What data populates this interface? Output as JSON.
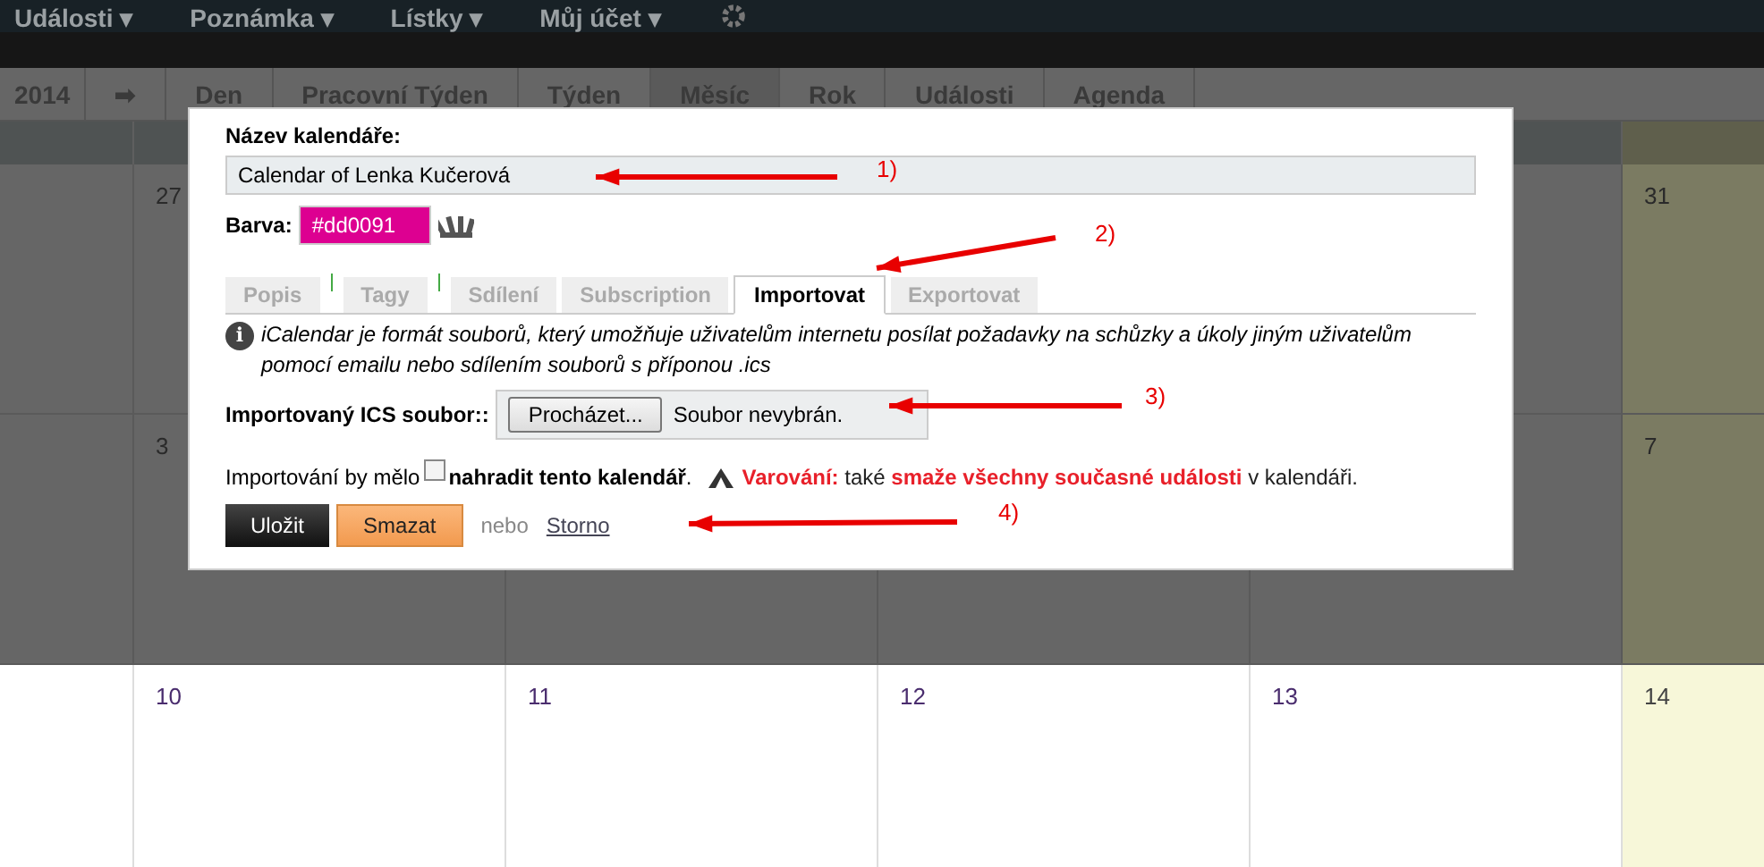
{
  "top_menu": [
    {
      "label": "Události",
      "caret": "▾"
    },
    {
      "label": "Poznámka",
      "caret": "▾"
    },
    {
      "label": "Lístky",
      "caret": "▾"
    },
    {
      "label": "Můj účet",
      "caret": "▾"
    }
  ],
  "toolbar": {
    "year": "2014",
    "next": "➡",
    "views": [
      {
        "label": "Den",
        "selected": false
      },
      {
        "label": "Pracovní Týden",
        "selected": false
      },
      {
        "label": "Týden",
        "selected": false
      },
      {
        "label": "Měsíc",
        "selected": true
      },
      {
        "label": "Rok",
        "selected": false
      },
      {
        "label": "Události",
        "selected": false
      },
      {
        "label": "Agenda",
        "selected": false
      }
    ]
  },
  "calendar": {
    "rows": [
      {
        "dimmed": true,
        "cells": [
          {
            "kind": "day",
            "day": "27"
          },
          {
            "kind": "empty"
          },
          {
            "kind": "empty"
          },
          {
            "kind": "empty"
          },
          {
            "kind": "day",
            "day": "31"
          }
        ]
      },
      {
        "dimmed": true,
        "cells": [
          {
            "kind": "day",
            "day": "3"
          },
          {
            "kind": "empty"
          },
          {
            "kind": "empty"
          },
          {
            "kind": "empty"
          },
          {
            "kind": "day",
            "day": "7"
          }
        ]
      },
      {
        "dimmed": false,
        "cells": [
          {
            "kind": "day",
            "day": "10"
          },
          {
            "kind": "day",
            "day": "11"
          },
          {
            "kind": "day",
            "day": "12"
          },
          {
            "kind": "day",
            "day": "13"
          },
          {
            "kind": "day",
            "day": "14"
          }
        ]
      }
    ]
  },
  "dialog": {
    "name_label": "Název kalendáře:",
    "name_value": "Calendar of Lenka Kučerová",
    "color_label": "Barva:",
    "color_value": "#dd0091",
    "tabs": [
      {
        "label": "Popis",
        "selected": false,
        "separator": false
      },
      {
        "label": "Tagy",
        "selected": false,
        "separator": true
      },
      {
        "label": "Sdílení",
        "selected": false,
        "separator": true
      },
      {
        "label": "Subscription",
        "selected": false,
        "separator": false
      },
      {
        "label": "Importovat",
        "selected": true,
        "separator": false
      },
      {
        "label": "Exportovat",
        "selected": false,
        "separator": false
      }
    ],
    "info_icon": "i",
    "info": "iCalendar je formát souborů, který umožňuje uživatelům internetu posílat požadavky na schůzky a úkoly jiným uživatelům pomocí emailu nebo sdílením souborů s příponou .ics",
    "file_label": "Importovaný ICS soubor::",
    "browse_button": "Procházet...",
    "file_status": "Soubor nevybrán.",
    "replace_text": "Importování by mělo",
    "replace_checked": false,
    "replace_label": "nahradit tento kalendář",
    "replace_end": ".",
    "warning": "**Varování:** také **smaže všechny současné události** v kalendáři.",
    "save_button": "Uložit",
    "delete_button": "Smazat",
    "or_text": "nebo",
    "cancel_link": "Storno"
  },
  "annotations": [
    {
      "label": "1)"
    },
    {
      "label": "2)"
    },
    {
      "label": "3)"
    },
    {
      "label": "4)"
    }
  ]
}
